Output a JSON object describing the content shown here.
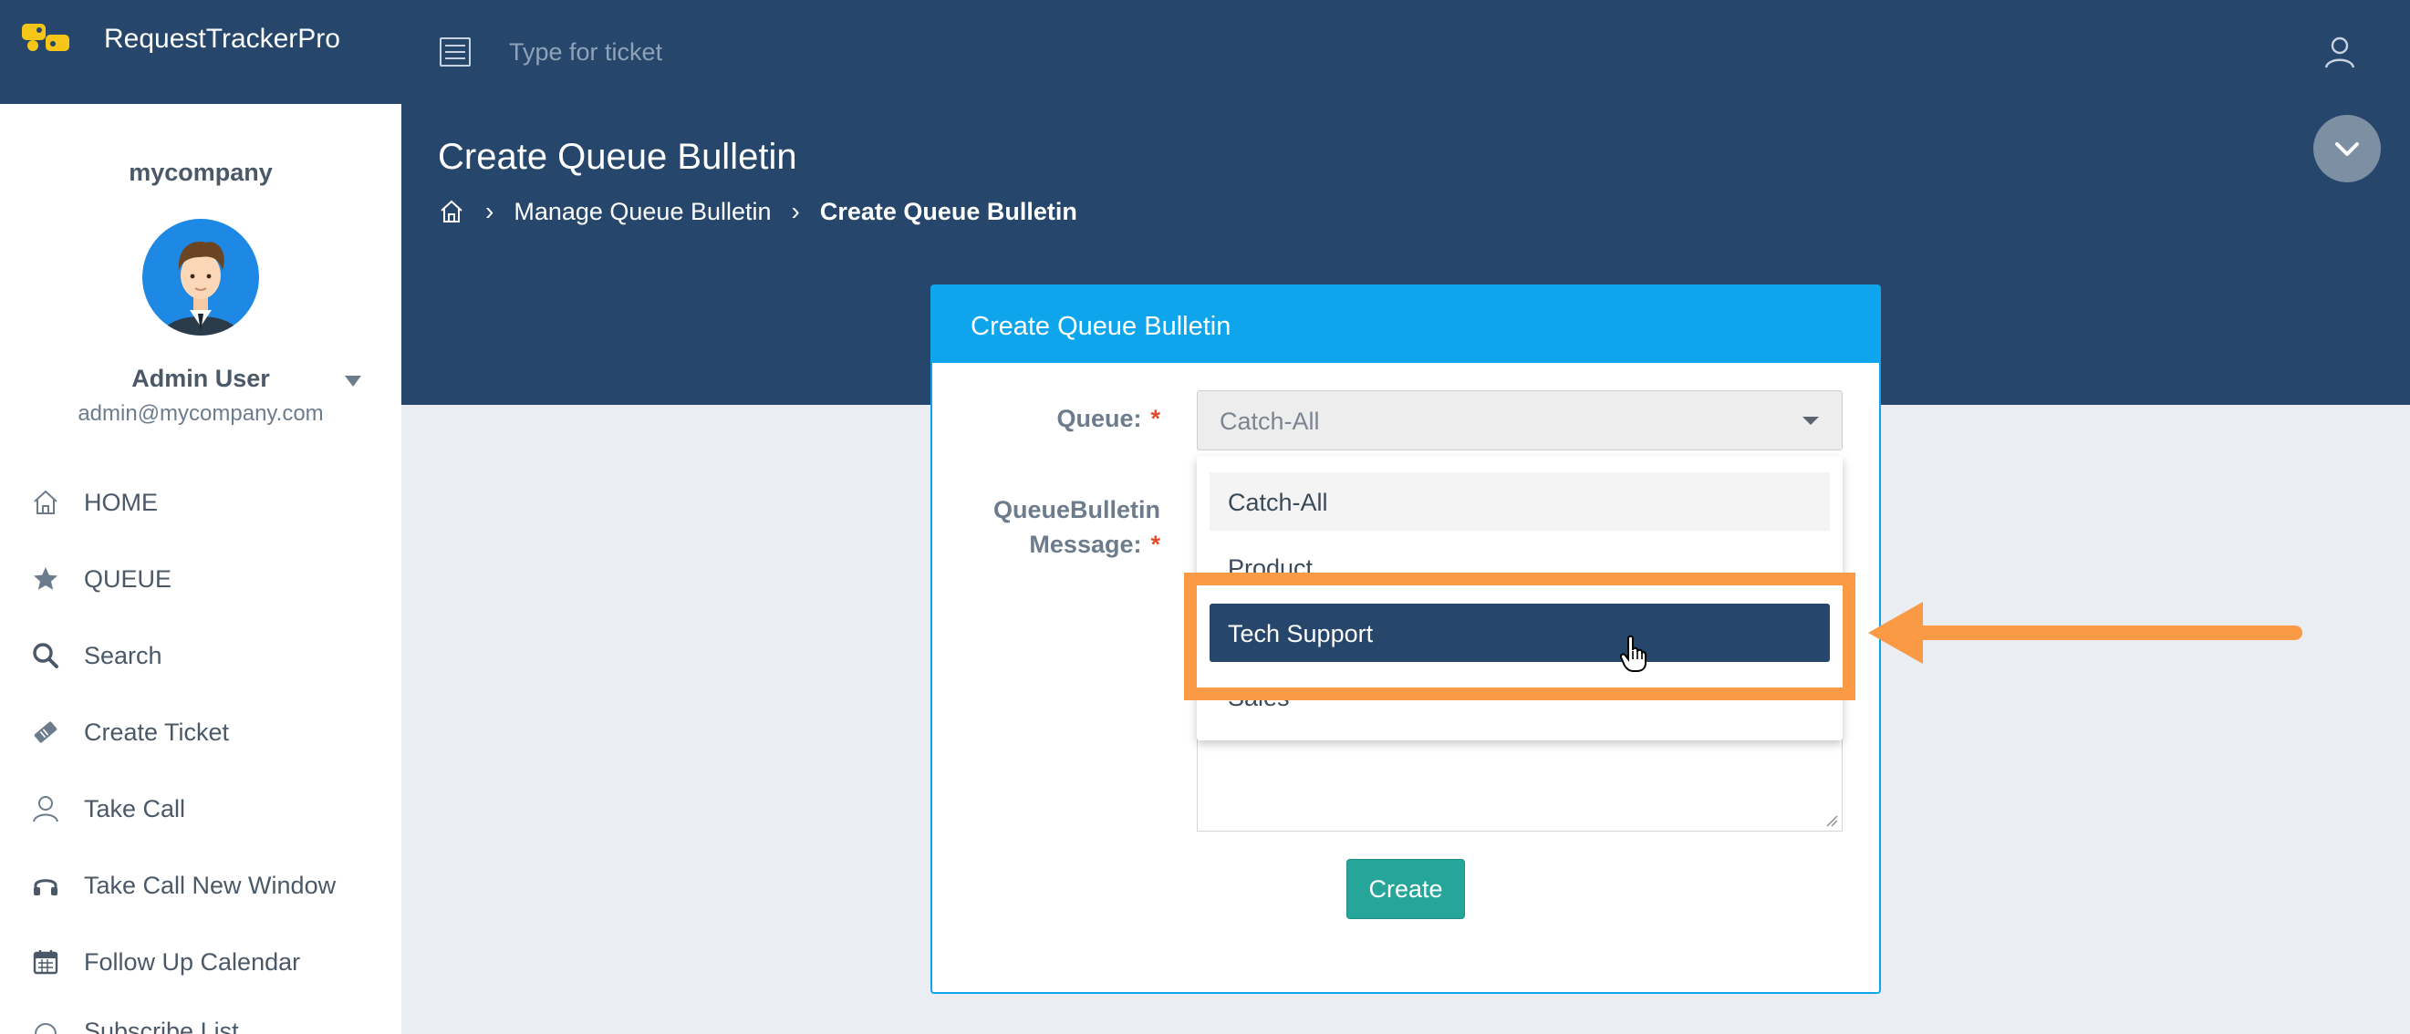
{
  "app": {
    "brand": "RequestTrackerPro",
    "search_placeholder": "Type for ticket"
  },
  "header": {
    "page_title": "Create Queue Bulletin",
    "breadcrumb": [
      "Manage Queue Bulletin",
      "Create Queue Bulletin"
    ]
  },
  "sidebar": {
    "company": "mycompany",
    "user_name": "Admin User",
    "user_email": "admin@mycompany.com",
    "items": [
      {
        "label": "HOME",
        "icon": "home-icon"
      },
      {
        "label": "QUEUE",
        "icon": "star-icon"
      },
      {
        "label": "Search",
        "icon": "search-icon"
      },
      {
        "label": "Create Ticket",
        "icon": "ticket-icon"
      },
      {
        "label": "Take Call",
        "icon": "person-icon"
      },
      {
        "label": "Take Call New Window",
        "icon": "headset-icon"
      },
      {
        "label": "Follow Up Calendar",
        "icon": "calendar-icon"
      },
      {
        "label": "Subscribe List",
        "icon": "list-icon"
      }
    ]
  },
  "form": {
    "card_title": "Create Queue Bulletin",
    "queue_label": "Queue:",
    "message_label_line1": "QueueBulletin",
    "message_label_line2": "Message:",
    "required_mark": "*",
    "queue_value": "Catch-All",
    "create_label": "Create",
    "dropdown_options": [
      "Catch-All",
      "Product",
      "Tech Support",
      "Sales"
    ],
    "dropdown_selected": "Tech Support"
  },
  "colors": {
    "navy": "#26476b",
    "card_header": "#0ea5ec",
    "create_button": "#26a69a",
    "highlight": "#fb9a45"
  }
}
